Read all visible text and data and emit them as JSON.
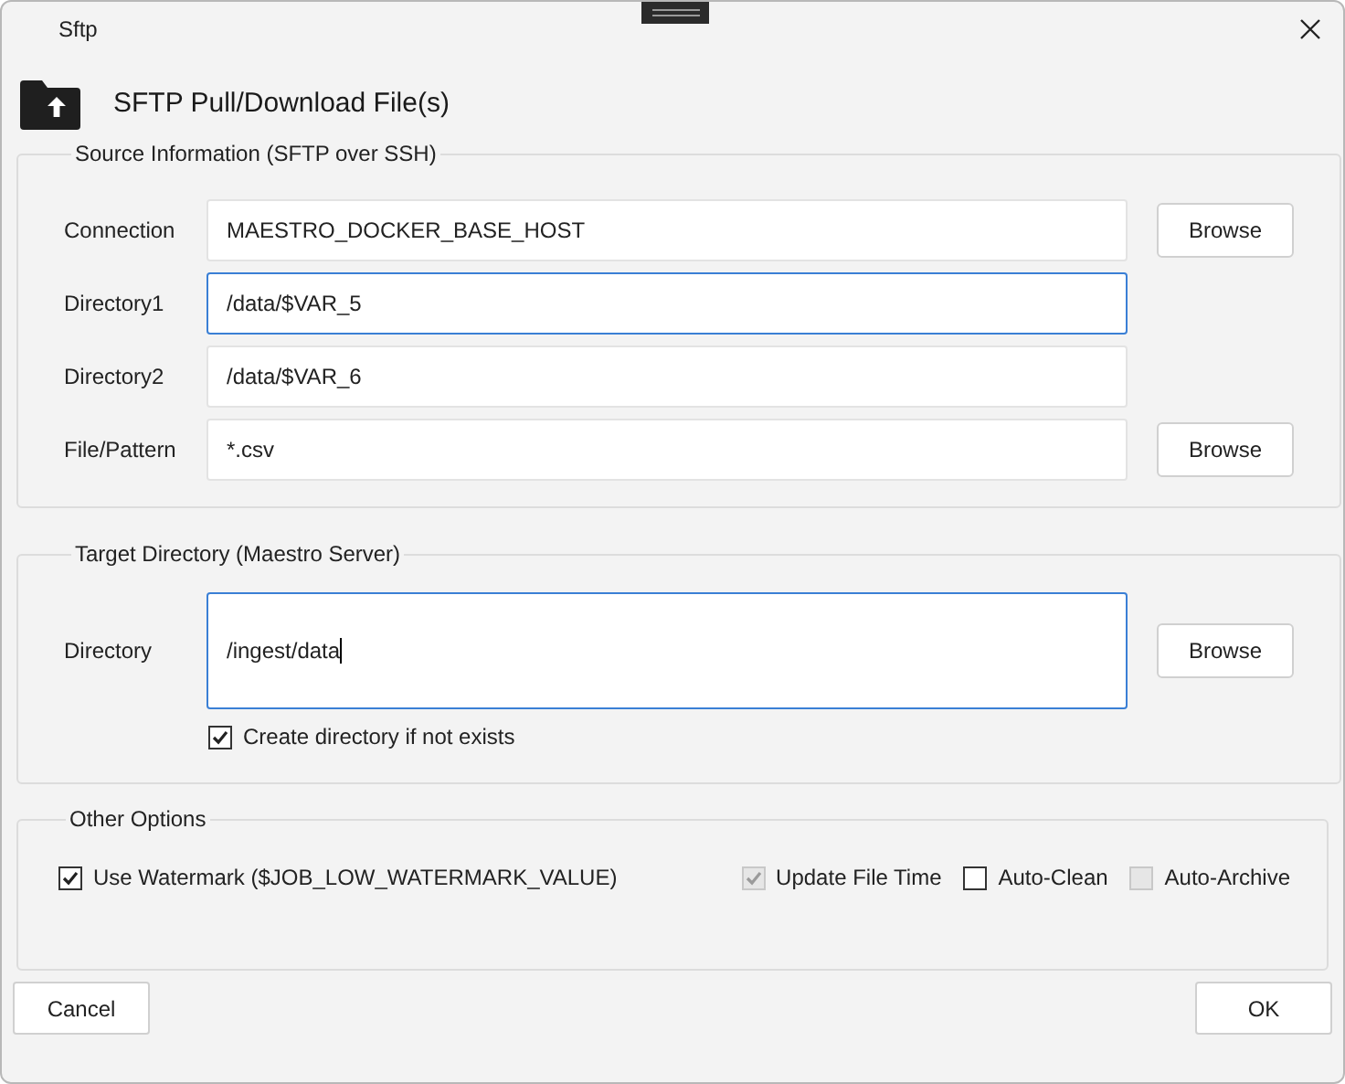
{
  "window": {
    "title": "Sftp"
  },
  "header": {
    "title": "SFTP Pull/Download File(s)"
  },
  "source": {
    "legend": "Source Information (SFTP over SSH)",
    "rows": [
      {
        "label": "Connection",
        "value": "MAESTRO_DOCKER_BASE_HOST",
        "focused": false,
        "browse": "Browse"
      },
      {
        "label": "Directory1",
        "value": "/data/$VAR_5",
        "focused": true
      },
      {
        "label": "Directory2",
        "value": "/data/$VAR_6",
        "focused": false
      },
      {
        "label": "File/Pattern",
        "value": "*.csv",
        "focused": false,
        "browse": "Browse"
      }
    ]
  },
  "target": {
    "legend": "Target Directory (Maestro Server)",
    "label": "Directory",
    "value": "/ingest/data",
    "browse": "Browse",
    "create": {
      "label": "Create directory if not exists",
      "checked": true,
      "disabled": false
    }
  },
  "other": {
    "legend": "Other Options",
    "options": [
      {
        "label": "Use Watermark ($JOB_LOW_WATERMARK_VALUE)",
        "checked": true,
        "disabled": false
      },
      {
        "label": "Update File Time",
        "checked": true,
        "disabled": true
      },
      {
        "label": "Auto-Clean",
        "checked": false,
        "disabled": false
      },
      {
        "label": "Auto-Archive",
        "checked": false,
        "disabled": true
      }
    ]
  },
  "buttons": {
    "cancel": "Cancel",
    "ok": "OK"
  }
}
